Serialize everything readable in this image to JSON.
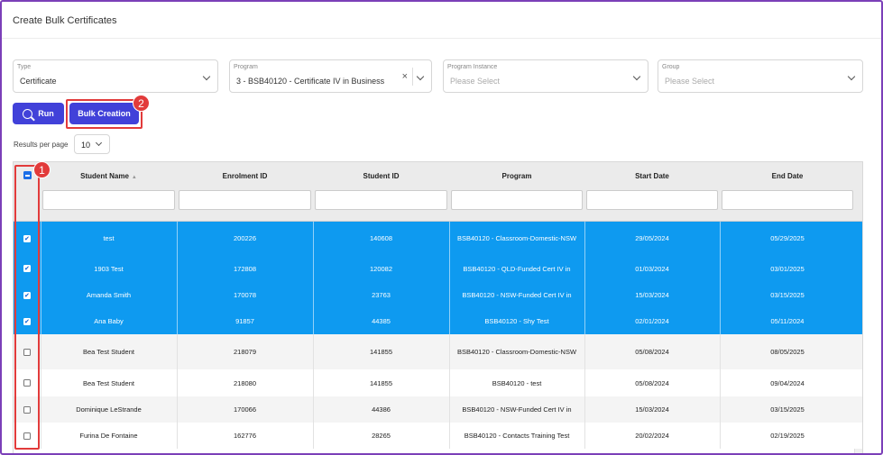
{
  "page": {
    "title": "Create Bulk Certificates"
  },
  "filters": [
    {
      "label": "Type",
      "value": "Certificate",
      "placeholder": false,
      "clearable": false
    },
    {
      "label": "Program",
      "value": "3 - BSB40120 - Certificate IV in Business",
      "placeholder": false,
      "clearable": true
    },
    {
      "label": "Program Instance",
      "value": "Please Select",
      "placeholder": true,
      "clearable": false
    },
    {
      "label": "Group",
      "value": "Please Select",
      "placeholder": true,
      "clearable": false
    }
  ],
  "buttons": {
    "run_label": "Run",
    "bulk_label": "Bulk Creation"
  },
  "annotations": {
    "badge_1": "1",
    "badge_2": "2"
  },
  "results_per_page": {
    "label": "Results per page",
    "value": "10"
  },
  "table": {
    "columns": [
      "Student Name",
      "Enrolment ID",
      "Student ID",
      "Program",
      "Start Date",
      "End Date"
    ],
    "rows": [
      {
        "selected": true,
        "name": "test",
        "enrolment_id": "200226",
        "student_id": "140608",
        "program": "BSB40120 - Classroom-Domestic-NSW",
        "start": "29/05/2024",
        "end": "05/29/2025"
      },
      {
        "selected": true,
        "name": "1903 Test",
        "enrolment_id": "172808",
        "student_id": "120082",
        "program": "BSB40120 - QLD-Funded Cert IV in",
        "start": "01/03/2024",
        "end": "03/01/2025"
      },
      {
        "selected": true,
        "name": "Amanda Smith",
        "enrolment_id": "170078",
        "student_id": "23763",
        "program": "BSB40120 - NSW-Funded Cert IV in",
        "start": "15/03/2024",
        "end": "03/15/2025"
      },
      {
        "selected": true,
        "name": "Ana Baby",
        "enrolment_id": "91857",
        "student_id": "44385",
        "program": "BSB40120 - Shy Test",
        "start": "02/01/2024",
        "end": "05/11/2024"
      },
      {
        "selected": false,
        "name": "Bea Test Student",
        "enrolment_id": "218079",
        "student_id": "141855",
        "program": "BSB40120 - Classroom-Domestic-NSW",
        "start": "05/08/2024",
        "end": "08/05/2025"
      },
      {
        "selected": false,
        "name": "Bea Test Student",
        "enrolment_id": "218080",
        "student_id": "141855",
        "program": "BSB40120 - test",
        "start": "05/08/2024",
        "end": "09/04/2024"
      },
      {
        "selected": false,
        "name": "Dominique LeStrande",
        "enrolment_id": "170066",
        "student_id": "44386",
        "program": "BSB40120 - NSW-Funded Cert IV in",
        "start": "15/03/2024",
        "end": "03/15/2025"
      },
      {
        "selected": false,
        "name": "Furina De Fontaine",
        "enrolment_id": "162776",
        "student_id": "28265",
        "program": "BSB40120 - Contacts Training Test",
        "start": "20/02/2024",
        "end": "02/19/2025"
      }
    ]
  },
  "colors": {
    "accent": "#4141d9",
    "selected_row": "#0e9af0",
    "highlight": "#e23b3b",
    "frame": "#7b3fb8"
  }
}
